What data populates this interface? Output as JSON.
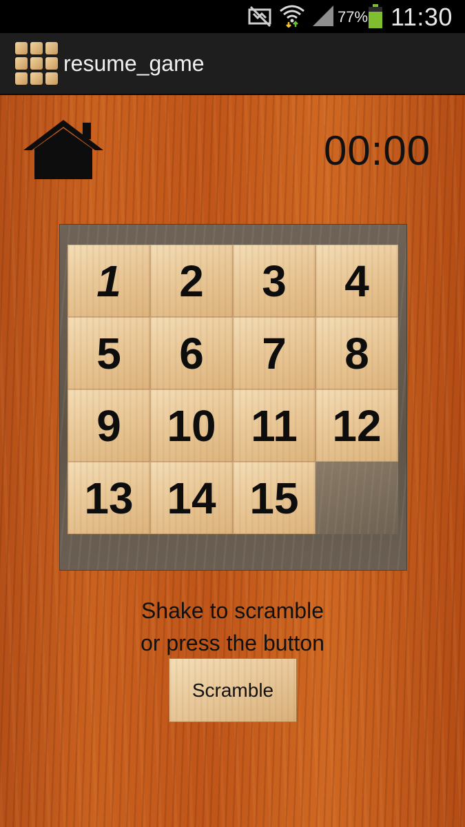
{
  "status_bar": {
    "battery_percent": "77%",
    "time": "11:30",
    "icons": [
      "mute-icon",
      "wifi-icon",
      "signal-icon",
      "battery-icon"
    ]
  },
  "action_bar": {
    "title": "resume_game",
    "icon": "grid-app-icon"
  },
  "game": {
    "timer": "00:00",
    "home_icon": "home-icon",
    "tiles": [
      "1",
      "2",
      "3",
      "4",
      "5",
      "6",
      "7",
      "8",
      "9",
      "10",
      "11",
      "12",
      "13",
      "14",
      "15",
      ""
    ],
    "hint_line1": "Shake to scramble",
    "hint_line2": "or press the button",
    "scramble_label": "Scramble"
  },
  "colors": {
    "wood": "#c15a1c",
    "tile": "#e9c898",
    "board": "#64594c",
    "text": "#111111"
  }
}
